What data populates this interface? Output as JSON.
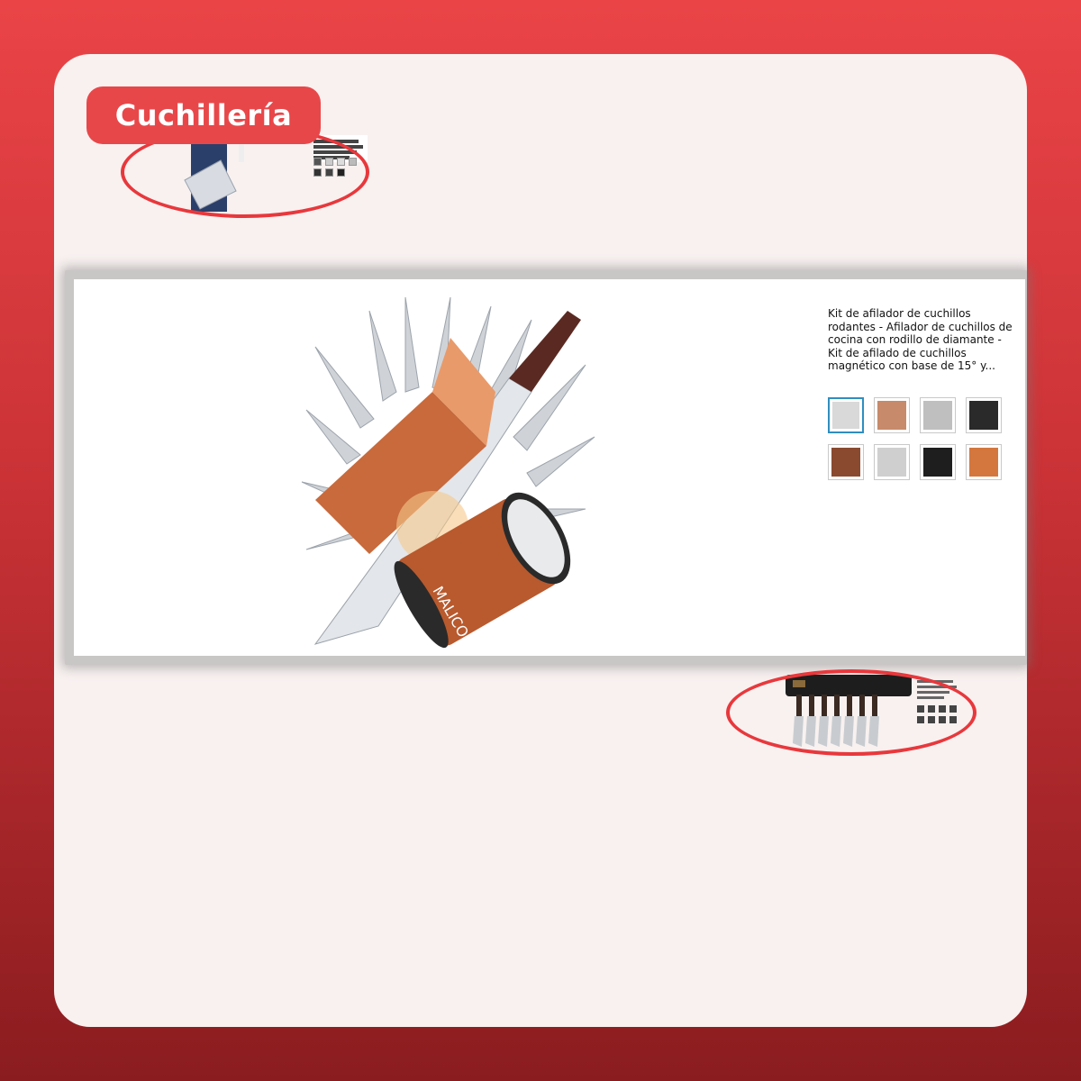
{
  "category_tag": "Cuchillería",
  "main_product": {
    "title": "Kit de afilador de cuchillos rodantes - Afilador de cuchillos de cocina con rodillo de diamante - Kit de afilado de cuchillos magnético con base de 15° y...",
    "brand_mark": "MALICO",
    "thumbnails": [
      {
        "name": "thumb-1",
        "selected": true,
        "color": "#d9d9d9"
      },
      {
        "name": "thumb-2",
        "selected": false,
        "color": "#c78a6a"
      },
      {
        "name": "thumb-3",
        "selected": false,
        "color": "#bfbfbf"
      },
      {
        "name": "thumb-4",
        "selected": false,
        "color": "#2a2a2a"
      },
      {
        "name": "thumb-5",
        "selected": false,
        "color": "#8a4a30"
      },
      {
        "name": "thumb-6",
        "selected": false,
        "color": "#cfcfcf"
      },
      {
        "name": "thumb-7",
        "selected": false,
        "color": "#1e1e1e"
      },
      {
        "name": "thumb-8",
        "selected": false,
        "color": "#d4773f"
      }
    ]
  },
  "colors": {
    "accent": "#e8474a",
    "highlight_ring": "#e8383c",
    "selected_thumb_border": "#2f8ec0"
  }
}
